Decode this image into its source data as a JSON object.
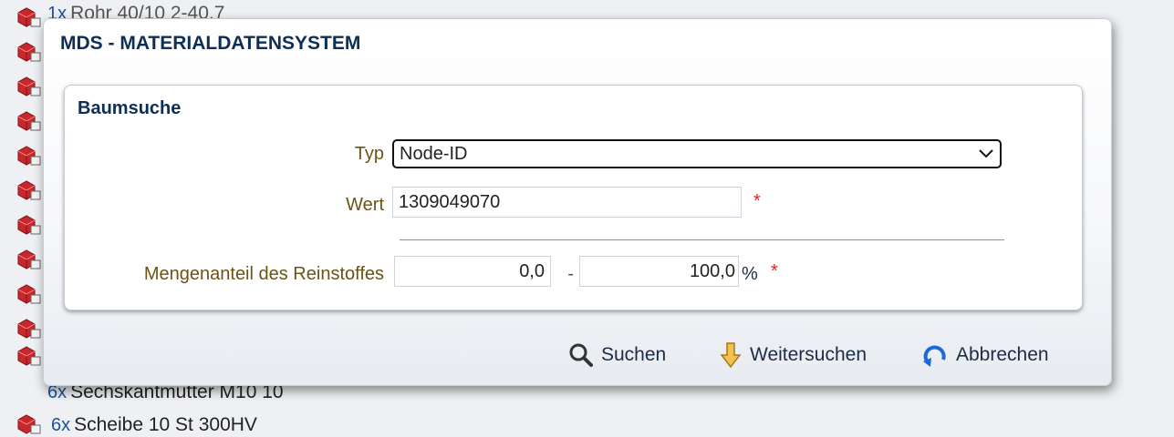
{
  "tree": {
    "rows": [
      {
        "qty": "1x",
        "text": "Rohr 40/10 2-40.7"
      },
      {
        "qty": "6x",
        "text": "Sechskantmutter M10 10"
      },
      {
        "qty": "6x",
        "text": "Scheibe 10 St 300HV"
      }
    ]
  },
  "dialog": {
    "title": "MDS - MATERIALDATENSYSTEM",
    "panel": {
      "title": "Baumsuche",
      "typ": {
        "label": "Typ",
        "value": "Node-ID"
      },
      "wert": {
        "label": "Wert",
        "value": "1309049070",
        "required_mark": "*"
      },
      "mengenanteil": {
        "label": "Mengenanteil des Reinstoffes",
        "from": "0,0",
        "separator": "-",
        "to": "100,0",
        "unit": "%",
        "required_mark": "*"
      }
    },
    "buttons": {
      "search": "Suchen",
      "continue": "Weitersuchen",
      "cancel": "Abbrechen"
    }
  },
  "colors": {
    "title": "#0d2f55",
    "label": "#6b5413",
    "required": "#e02020",
    "qty": "#1f4fa0"
  },
  "icons": [
    "cube-icon",
    "search-icon",
    "arrow-down-icon",
    "undo-icon",
    "chevron-down-icon"
  ]
}
